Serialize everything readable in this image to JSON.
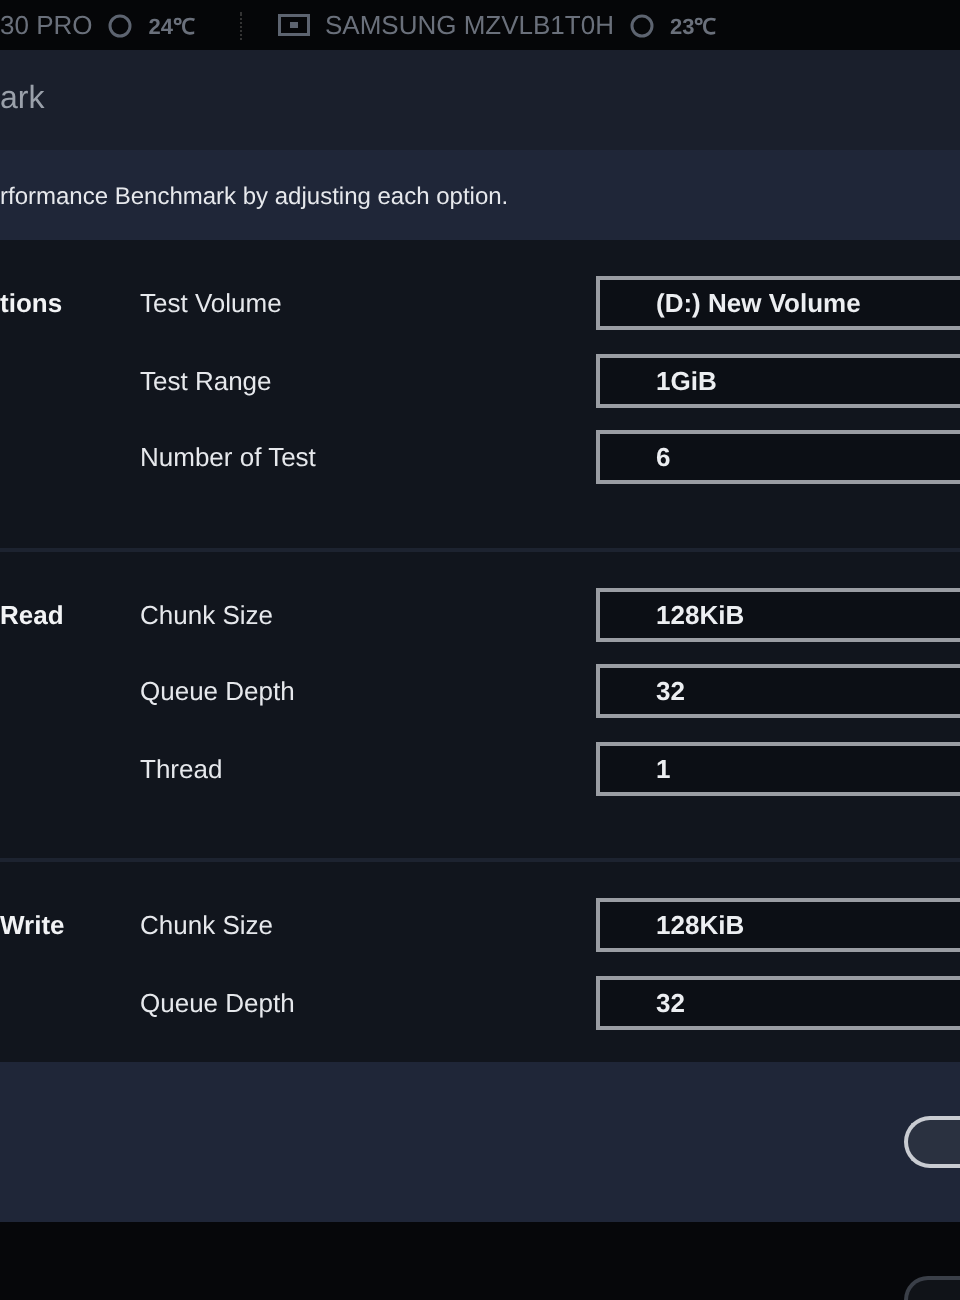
{
  "status_bar": {
    "items": [
      {
        "kind": "text",
        "text": "30 PRO"
      },
      {
        "kind": "temp",
        "text": "24℃"
      },
      {
        "kind": "drive",
        "text": "SAMSUNG MZVLB1T0H"
      },
      {
        "kind": "temp",
        "text": "23℃"
      }
    ]
  },
  "header": {
    "title": "ark"
  },
  "description": "rformance Benchmark by adjusting each option.",
  "sections": [
    {
      "label": "tions",
      "rows": [
        {
          "label": "Test Volume",
          "value": "(D:) New Volume"
        },
        {
          "label": "Test Range",
          "value": "1GiB"
        },
        {
          "label": "Number of Test",
          "value": "6"
        }
      ]
    },
    {
      "label": "Read",
      "rows": [
        {
          "label": "Chunk Size",
          "value": "128KiB"
        },
        {
          "label": "Queue Depth",
          "value": "32"
        },
        {
          "label": "Thread",
          "value": "1"
        }
      ]
    },
    {
      "label": "Write",
      "rows": [
        {
          "label": "Chunk Size",
          "value": "128KiB"
        },
        {
          "label": "Queue Depth",
          "value": "32"
        }
      ]
    }
  ]
}
